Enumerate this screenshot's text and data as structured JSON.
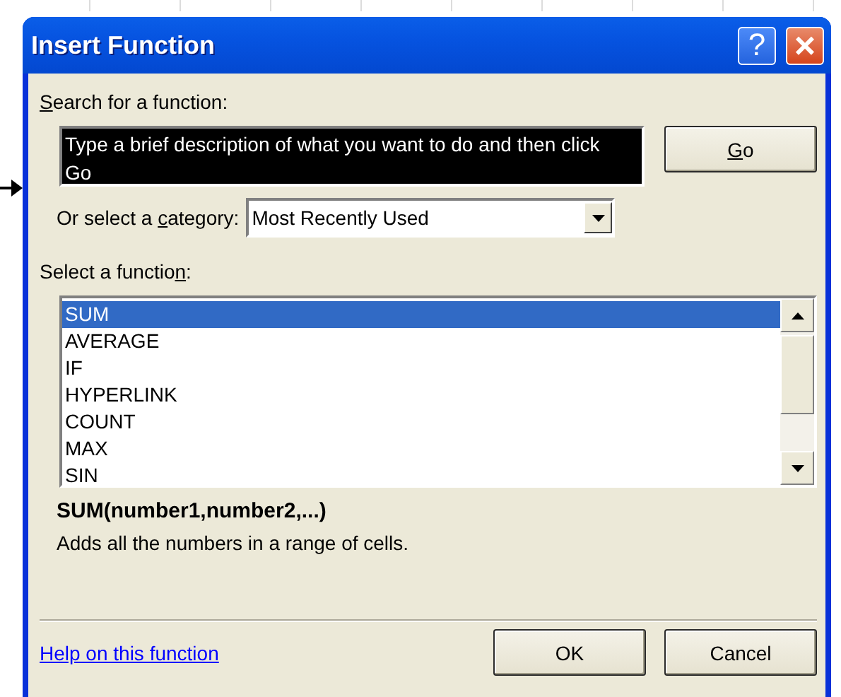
{
  "window": {
    "title": "Insert Function",
    "help_button": "?",
    "close_button": "×"
  },
  "search": {
    "label": {
      "key": "S",
      "after": "earch for a function:"
    },
    "value": "Type a brief description of what you want to do and then click Go",
    "value_selected": true,
    "button": {
      "key": "G",
      "after": "o"
    }
  },
  "category": {
    "label": {
      "before": "Or select a ",
      "key": "c",
      "after": "ategory:"
    },
    "value": "Most Recently Used"
  },
  "functions": {
    "label": {
      "before": "Select a functio",
      "key": "n",
      "after": ":"
    },
    "items": [
      {
        "label": "SUM",
        "selected": true
      },
      {
        "label": "AVERAGE",
        "selected": false
      },
      {
        "label": "IF",
        "selected": false
      },
      {
        "label": "HYPERLINK",
        "selected": false
      },
      {
        "label": "COUNT",
        "selected": false
      },
      {
        "label": "MAX",
        "selected": false
      },
      {
        "label": "SIN",
        "selected": false
      }
    ]
  },
  "signature": "SUM(number1,number2,...)",
  "description": "Adds all the numbers in a range of cells.",
  "help_link": "Help on this function",
  "buttons": [
    "OK",
    "Cancel"
  ]
}
